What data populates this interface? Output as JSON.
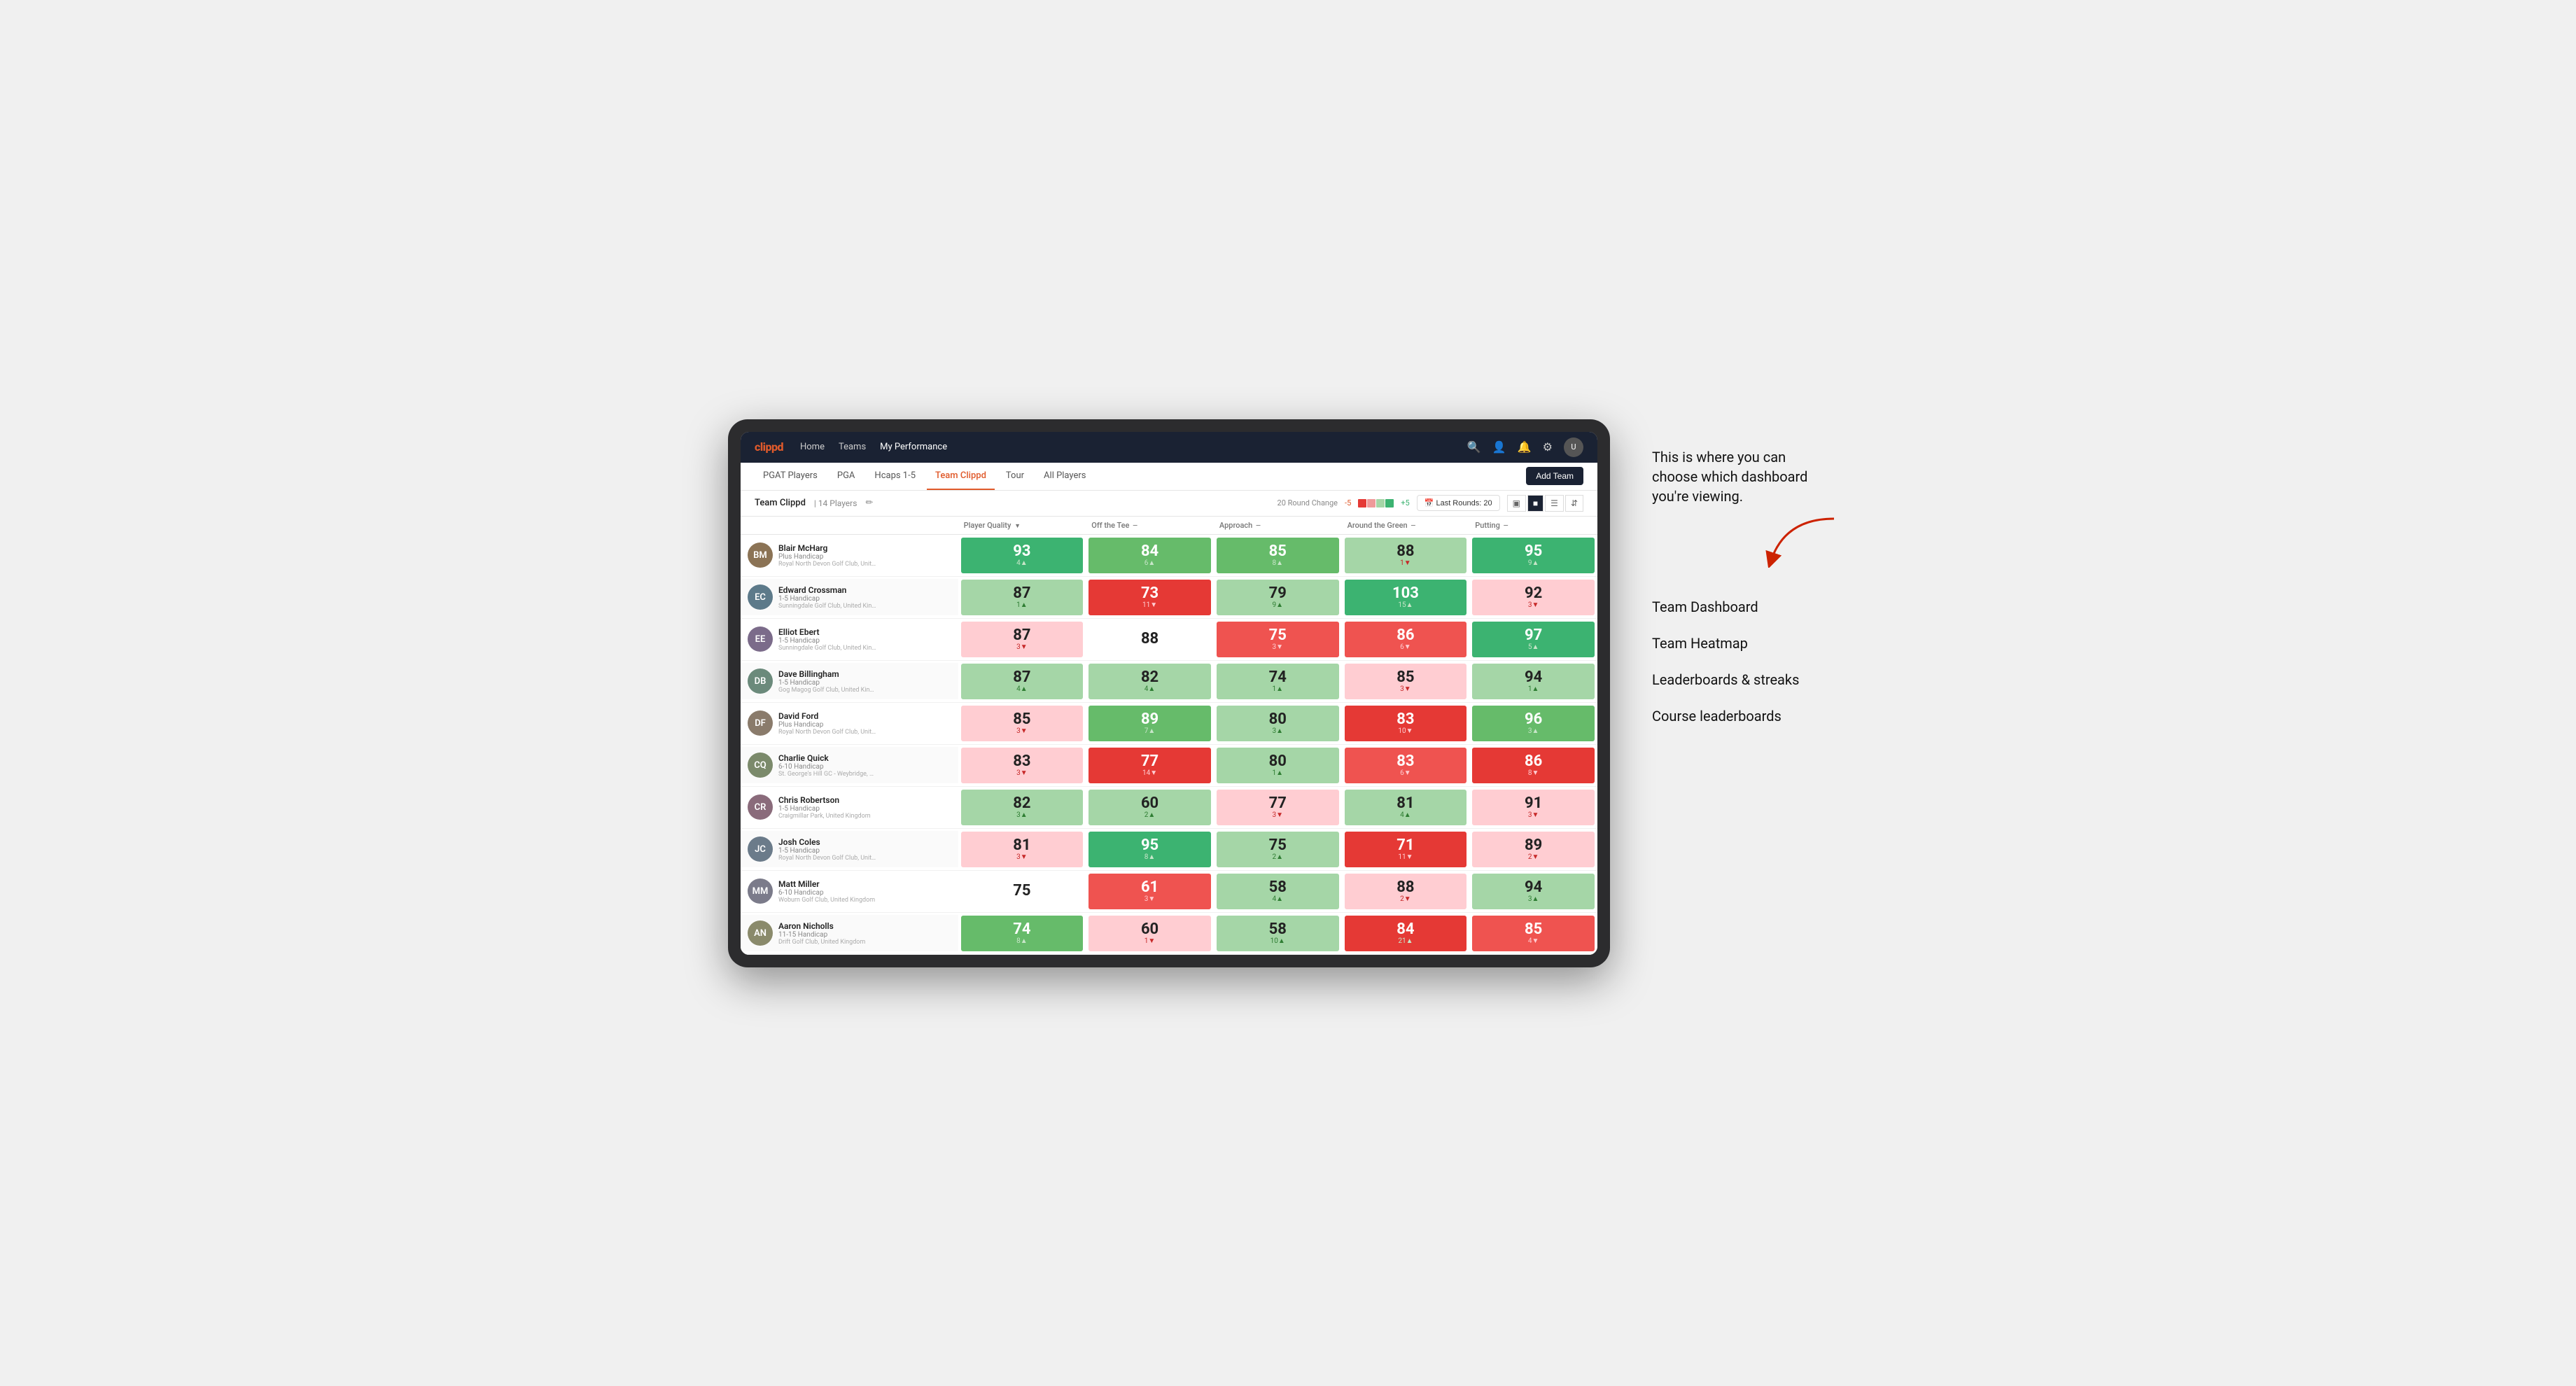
{
  "app": {
    "logo": "clippd",
    "nav_links": [
      {
        "label": "Home",
        "active": false
      },
      {
        "label": "Teams",
        "active": false
      },
      {
        "label": "My Performance",
        "active": true
      }
    ],
    "nav_icons": [
      "search",
      "person",
      "bell",
      "settings",
      "avatar"
    ]
  },
  "tabs": [
    {
      "label": "PGAT Players",
      "active": false
    },
    {
      "label": "PGA",
      "active": false
    },
    {
      "label": "Hcaps 1-5",
      "active": false
    },
    {
      "label": "Team Clippd",
      "active": true
    },
    {
      "label": "Tour",
      "active": false
    },
    {
      "label": "All Players",
      "active": false
    }
  ],
  "add_team_label": "Add Team",
  "sub_header": {
    "team_name": "Team Clippd",
    "separator": "|",
    "player_count": "14 Players",
    "round_change_label": "20 Round Change",
    "round_change_neg": "-5",
    "round_change_pos": "+5",
    "last_rounds_label": "Last Rounds:",
    "last_rounds_value": "20"
  },
  "table": {
    "columns": [
      {
        "label": "Player Quality",
        "sort": true,
        "key": "player_quality"
      },
      {
        "label": "Off the Tee",
        "sort": true,
        "key": "off_tee"
      },
      {
        "label": "Approach",
        "sort": true,
        "key": "approach"
      },
      {
        "label": "Around the Green",
        "sort": true,
        "key": "around_green"
      },
      {
        "label": "Putting",
        "sort": true,
        "key": "putting"
      }
    ],
    "rows": [
      {
        "name": "Blair McHarg",
        "handicap": "Plus Handicap",
        "club": "Royal North Devon Golf Club, United Kingdom",
        "initials": "BM",
        "avatar_color": "#8B7355",
        "player_quality": {
          "value": "93",
          "change": "4",
          "direction": "up",
          "bg": "green-strong"
        },
        "off_tee": {
          "value": "84",
          "change": "6",
          "direction": "up",
          "bg": "green-mid"
        },
        "approach": {
          "value": "85",
          "change": "8",
          "direction": "up",
          "bg": "green-mid"
        },
        "around_green": {
          "value": "88",
          "change": "1",
          "direction": "down",
          "bg": "green-light"
        },
        "putting": {
          "value": "95",
          "change": "9",
          "direction": "up",
          "bg": "green-strong"
        }
      },
      {
        "name": "Edward Crossman",
        "handicap": "1-5 Handicap",
        "club": "Sunningdale Golf Club, United Kingdom",
        "initials": "EC",
        "avatar_color": "#5D7A8A",
        "player_quality": {
          "value": "87",
          "change": "1",
          "direction": "up",
          "bg": "green-light"
        },
        "off_tee": {
          "value": "73",
          "change": "11",
          "direction": "down",
          "bg": "red-strong"
        },
        "approach": {
          "value": "79",
          "change": "9",
          "direction": "up",
          "bg": "green-light"
        },
        "around_green": {
          "value": "103",
          "change": "15",
          "direction": "up",
          "bg": "green-strong"
        },
        "putting": {
          "value": "92",
          "change": "3",
          "direction": "down",
          "bg": "red-light"
        }
      },
      {
        "name": "Elliot Ebert",
        "handicap": "1-5 Handicap",
        "club": "Sunningdale Golf Club, United Kingdom",
        "initials": "EE",
        "avatar_color": "#7B6B8A",
        "player_quality": {
          "value": "87",
          "change": "3",
          "direction": "down",
          "bg": "red-light"
        },
        "off_tee": {
          "value": "88",
          "change": "",
          "direction": "none",
          "bg": "white"
        },
        "approach": {
          "value": "75",
          "change": "3",
          "direction": "down",
          "bg": "red-mid"
        },
        "around_green": {
          "value": "86",
          "change": "6",
          "direction": "down",
          "bg": "red-mid"
        },
        "putting": {
          "value": "97",
          "change": "5",
          "direction": "up",
          "bg": "green-strong"
        }
      },
      {
        "name": "Dave Billingham",
        "handicap": "1-5 Handicap",
        "club": "Gog Magog Golf Club, United Kingdom",
        "initials": "DB",
        "avatar_color": "#6B8A7B",
        "player_quality": {
          "value": "87",
          "change": "4",
          "direction": "up",
          "bg": "green-light"
        },
        "off_tee": {
          "value": "82",
          "change": "4",
          "direction": "up",
          "bg": "green-light"
        },
        "approach": {
          "value": "74",
          "change": "1",
          "direction": "up",
          "bg": "green-light"
        },
        "around_green": {
          "value": "85",
          "change": "3",
          "direction": "down",
          "bg": "red-light"
        },
        "putting": {
          "value": "94",
          "change": "1",
          "direction": "up",
          "bg": "green-light"
        }
      },
      {
        "name": "David Ford",
        "handicap": "Plus Handicap",
        "club": "Royal North Devon Golf Club, United Kingdom",
        "initials": "DF",
        "avatar_color": "#8A7B6B",
        "player_quality": {
          "value": "85",
          "change": "3",
          "direction": "down",
          "bg": "red-light"
        },
        "off_tee": {
          "value": "89",
          "change": "7",
          "direction": "up",
          "bg": "green-mid"
        },
        "approach": {
          "value": "80",
          "change": "3",
          "direction": "up",
          "bg": "green-light"
        },
        "around_green": {
          "value": "83",
          "change": "10",
          "direction": "down",
          "bg": "red-strong"
        },
        "putting": {
          "value": "96",
          "change": "3",
          "direction": "up",
          "bg": "green-mid"
        }
      },
      {
        "name": "Charlie Quick",
        "handicap": "6-10 Handicap",
        "club": "St. George's Hill GC - Weybridge, Surrey, Uni...",
        "initials": "CQ",
        "avatar_color": "#7B8A6B",
        "player_quality": {
          "value": "83",
          "change": "3",
          "direction": "down",
          "bg": "red-light"
        },
        "off_tee": {
          "value": "77",
          "change": "14",
          "direction": "down",
          "bg": "red-strong"
        },
        "approach": {
          "value": "80",
          "change": "1",
          "direction": "up",
          "bg": "green-light"
        },
        "around_green": {
          "value": "83",
          "change": "6",
          "direction": "down",
          "bg": "red-mid"
        },
        "putting": {
          "value": "86",
          "change": "8",
          "direction": "down",
          "bg": "red-strong"
        }
      },
      {
        "name": "Chris Robertson",
        "handicap": "1-5 Handicap",
        "club": "Craigmillar Park, United Kingdom",
        "initials": "CR",
        "avatar_color": "#8A6B7B",
        "player_quality": {
          "value": "82",
          "change": "3",
          "direction": "up",
          "bg": "green-light"
        },
        "off_tee": {
          "value": "60",
          "change": "2",
          "direction": "up",
          "bg": "green-light"
        },
        "approach": {
          "value": "77",
          "change": "3",
          "direction": "down",
          "bg": "red-light"
        },
        "around_green": {
          "value": "81",
          "change": "4",
          "direction": "up",
          "bg": "green-light"
        },
        "putting": {
          "value": "91",
          "change": "3",
          "direction": "down",
          "bg": "red-light"
        }
      },
      {
        "name": "Josh Coles",
        "handicap": "1-5 Handicap",
        "club": "Royal North Devon Golf Club, United Kingdom",
        "initials": "JC",
        "avatar_color": "#6B7B8A",
        "player_quality": {
          "value": "81",
          "change": "3",
          "direction": "down",
          "bg": "red-light"
        },
        "off_tee": {
          "value": "95",
          "change": "8",
          "direction": "up",
          "bg": "green-strong"
        },
        "approach": {
          "value": "75",
          "change": "2",
          "direction": "up",
          "bg": "green-light"
        },
        "around_green": {
          "value": "71",
          "change": "11",
          "direction": "down",
          "bg": "red-strong"
        },
        "putting": {
          "value": "89",
          "change": "2",
          "direction": "down",
          "bg": "red-light"
        }
      },
      {
        "name": "Matt Miller",
        "handicap": "6-10 Handicap",
        "club": "Woburn Golf Club, United Kingdom",
        "initials": "MM",
        "avatar_color": "#7B7B8A",
        "player_quality": {
          "value": "75",
          "change": "",
          "direction": "none",
          "bg": "white"
        },
        "off_tee": {
          "value": "61",
          "change": "3",
          "direction": "down",
          "bg": "red-mid"
        },
        "approach": {
          "value": "58",
          "change": "4",
          "direction": "up",
          "bg": "green-light"
        },
        "around_green": {
          "value": "88",
          "change": "2",
          "direction": "down",
          "bg": "red-light"
        },
        "putting": {
          "value": "94",
          "change": "3",
          "direction": "up",
          "bg": "green-light"
        }
      },
      {
        "name": "Aaron Nicholls",
        "handicap": "11-15 Handicap",
        "club": "Drift Golf Club, United Kingdom",
        "initials": "AN",
        "avatar_color": "#8A8A6B",
        "player_quality": {
          "value": "74",
          "change": "8",
          "direction": "up",
          "bg": "green-mid"
        },
        "off_tee": {
          "value": "60",
          "change": "1",
          "direction": "down",
          "bg": "red-light"
        },
        "approach": {
          "value": "58",
          "change": "10",
          "direction": "up",
          "bg": "green-light"
        },
        "around_green": {
          "value": "84",
          "change": "21",
          "direction": "up",
          "bg": "red-strong"
        },
        "putting": {
          "value": "85",
          "change": "4",
          "direction": "down",
          "bg": "red-mid"
        }
      }
    ]
  },
  "callout": {
    "text": "This is where you can choose which dashboard you're viewing.",
    "options": [
      {
        "label": "Team Dashboard"
      },
      {
        "label": "Team Heatmap"
      },
      {
        "label": "Leaderboards & streaks"
      },
      {
        "label": "Course leaderboards"
      }
    ]
  }
}
